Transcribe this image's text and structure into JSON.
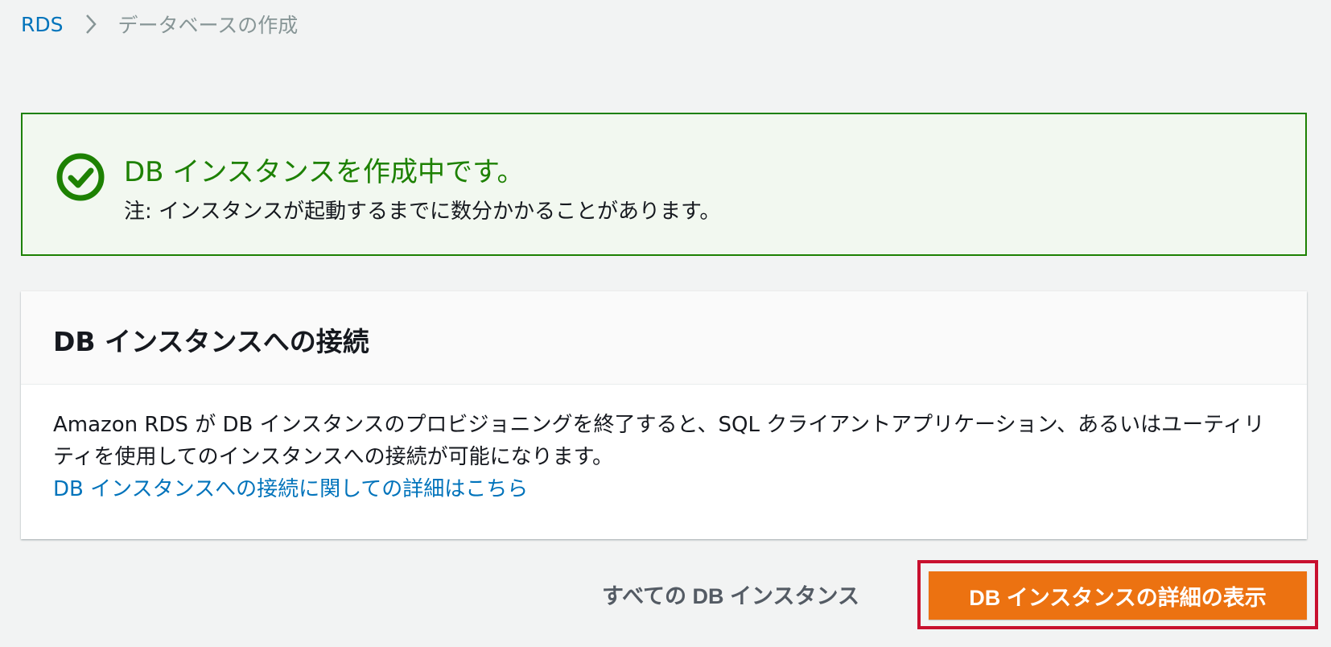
{
  "breadcrumb": {
    "root": "RDS",
    "current": "データベースの作成"
  },
  "alert": {
    "title": "DB インスタンスを作成中です。",
    "note": "注: インスタンスが起動するまでに数分かかることがあります。",
    "icon": "success-check-icon",
    "color": "#1d8102"
  },
  "connect_panel": {
    "title": "DB インスタンスへの接続",
    "description": "Amazon RDS が DB インスタンスのプロビジョニングを終了すると、SQL クライアントアプリケーション、あるいはユーティリティを使用してのインスタンスへの接続が可能になります。",
    "link": "DB インスタンスへの接続に関しての詳細はこちら"
  },
  "actions": {
    "all_instances_label": "すべての DB インスタンス",
    "view_details_label": "DB インスタンスの詳細の表示",
    "primary_color": "#ec7211",
    "highlight_color": "#c8102e"
  }
}
